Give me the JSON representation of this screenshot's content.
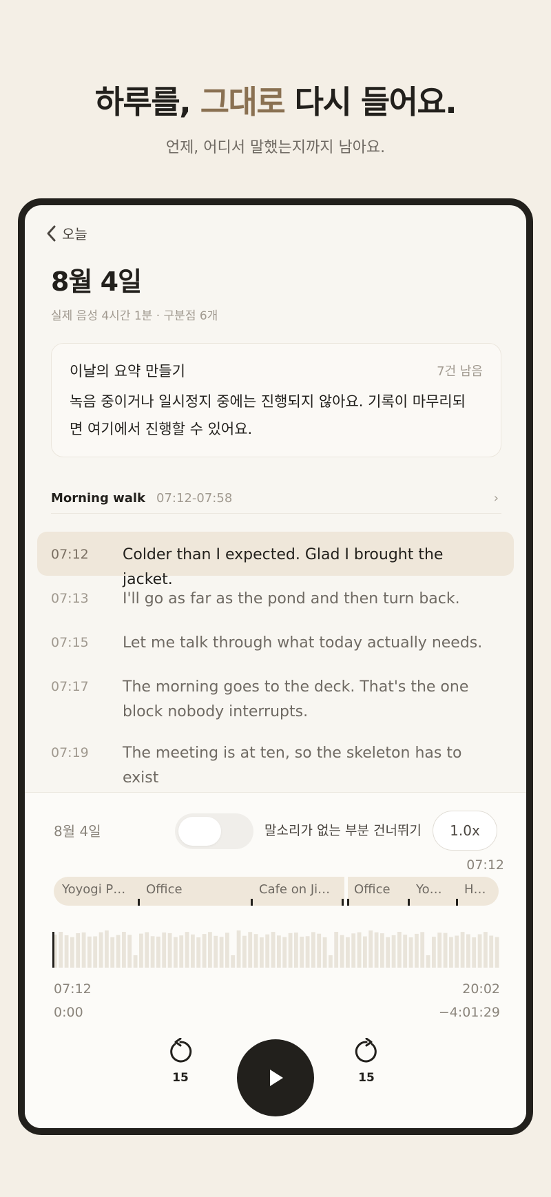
{
  "hero": {
    "headline_pre": "하루를,",
    "headline_accent": "그대로",
    "headline_post": "다시 들어요.",
    "subtitle": "언제, 어디서 말했는지까지 남아요."
  },
  "colors": {
    "accent": "#8a7152",
    "ink": "#22201c",
    "highlight": "#efe7da",
    "background": "#f4efe6"
  },
  "nav": {
    "back_label": "오늘",
    "back_icon": "chevron-left-icon"
  },
  "day": {
    "title": "8월 4일",
    "meta": "실제 음성 4시간 1분 · 구분점 6개"
  },
  "summary": {
    "title": "이날의 요약 만들기",
    "remaining": "7건 남음",
    "body": "녹음 중이거나 일시정지 중에는 진행되지 않아요. 기록이 마무리되면 여기에서 진행할 수 있어요."
  },
  "section": {
    "name": "Morning walk",
    "range": "07:12-07:58",
    "chevron": "›"
  },
  "transcript": [
    {
      "time": "07:12",
      "text": "Colder than I expected. Glad I brought the jacket.",
      "active": true
    },
    {
      "time": "07:13",
      "text": "I'll go as far as the pond and then turn back.",
      "active": false
    },
    {
      "time": "07:15",
      "text": "Let me talk through what today actually needs.",
      "active": false
    },
    {
      "time": "07:17",
      "text": "The morning goes to the deck. That's the one block nobody interrupts.",
      "active": false
    },
    {
      "time": "07:19",
      "text": "The meeting is at ten, so the skeleton has to exist",
      "active": false
    }
  ],
  "player": {
    "date": "8월 4일",
    "skip_silence_label": "말소리가 없는 부분 건너뛰기",
    "skip_silence_on": false,
    "speed": "1.0x",
    "current_clock": "07:12",
    "segments": [
      "Yoyogi P…",
      "Office",
      "Cafe on Ji…",
      "Office",
      "Yo…",
      "H…"
    ],
    "start_clock": "07:12",
    "end_clock": "20:02",
    "elapsed": "0:00",
    "remaining": "−4:01:29",
    "progress": 0.0,
    "rewind_seconds": "15",
    "forward_seconds": "15",
    "icons": {
      "rewind": "rewind-15-icon",
      "play": "play-icon",
      "forward": "forward-15-icon"
    }
  }
}
